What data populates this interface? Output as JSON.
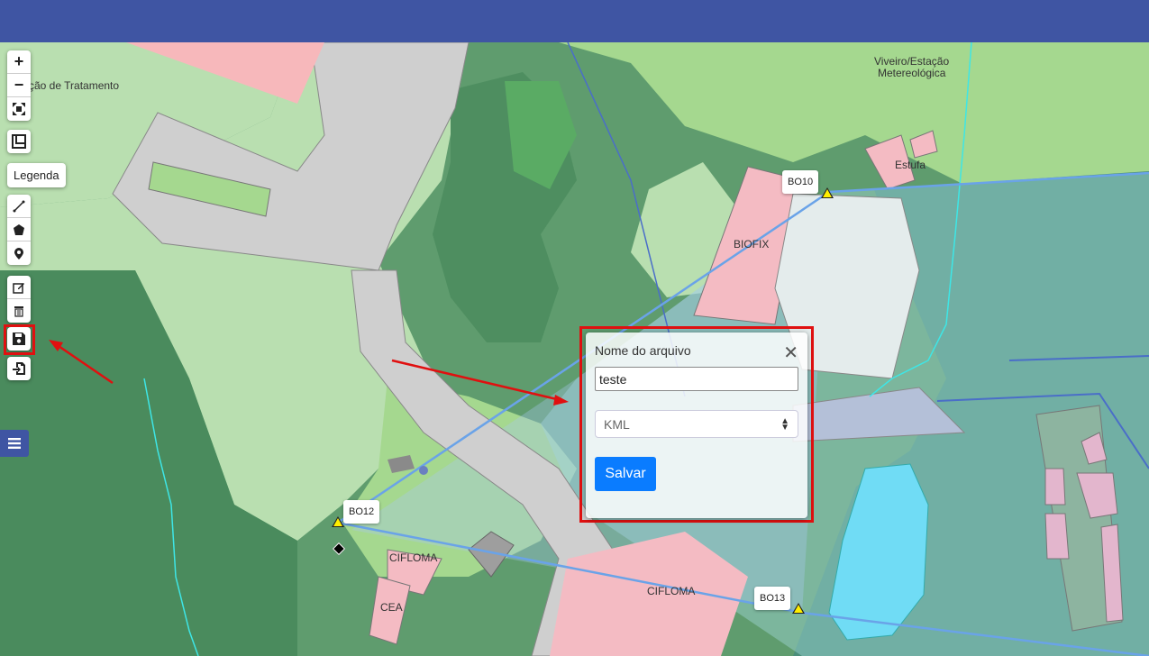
{
  "map": {
    "labels": {
      "treatment": "ção de Tratamento",
      "viveiro": "Viveiro/Estação",
      "metereologica": "Metereológica",
      "estufa": "Estufa",
      "biofix": "BIOFIX",
      "cifloma_left": "CIFLOMA",
      "cea": "CEA",
      "cifloma_bottom": "CIFLOMA"
    },
    "markers": [
      {
        "label": "BO10"
      },
      {
        "label": "BO12"
      },
      {
        "label": "BO13"
      }
    ]
  },
  "controls": {
    "zoom_in": "+",
    "zoom_out": "−",
    "legend_label": "Legenda"
  },
  "icons": {
    "zoom_in": "plus-icon",
    "zoom_out": "minus-icon",
    "fullscreen": "fullscreen-icon",
    "ruler": "ruler-icon",
    "line": "polyline-icon",
    "polygon": "polygon-icon",
    "marker": "map-pin-icon",
    "edit": "edit-icon",
    "delete": "trash-icon",
    "save": "floppy-disk-icon",
    "import": "file-import-icon",
    "menu": "hamburger-menu-icon"
  },
  "dialog": {
    "title": "Nome do arquivo",
    "close": "✕",
    "filename_value": "teste",
    "format_selected": "KML",
    "save_label": "Salvar"
  },
  "colors": {
    "topbar": "#3f55a3",
    "save_button": "#0a7cff",
    "highlight": "#e01010"
  }
}
